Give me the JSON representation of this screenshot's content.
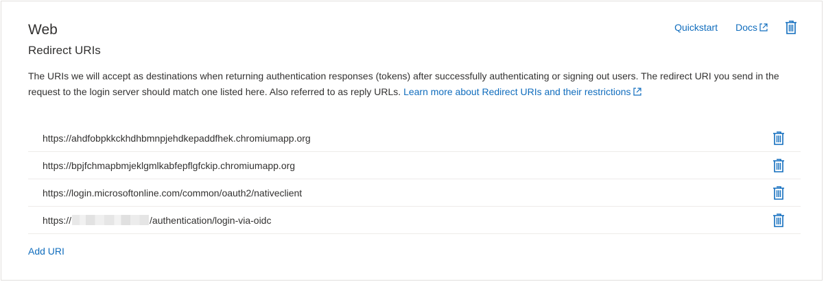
{
  "section": {
    "title": "Web",
    "subtitle": "Redirect URIs",
    "quickstart_label": "Quickstart",
    "docs_label": "Docs",
    "description_text": "The URIs we will accept as destinations when returning authentication responses (tokens) after successfully authenticating or signing out users. The redirect URI you send in the request to the login server should match one listed here. Also referred to as reply URLs. ",
    "learn_more_label": "Learn more about Redirect URIs and their restrictions",
    "add_uri_label": "Add URI"
  },
  "redirect_uris": [
    {
      "prefix": "https://ahdfobpkkckhdhbmnpjehdkepaddfhek.chromiumapp.org",
      "suffix": ""
    },
    {
      "prefix": "https://bpjfchmapbmjeklgmlkabfepflgfckip.chromiumapp.org",
      "suffix": ""
    },
    {
      "prefix": "https://login.microsoftonline.com/common/oauth2/nativeclient",
      "suffix": ""
    },
    {
      "prefix": "https://",
      "suffix": "/authentication/login-via-oidc",
      "redacted": true
    }
  ],
  "icons": {
    "delete": "trash-icon",
    "external": "external-link-icon"
  },
  "colors": {
    "accent": "#0f6cbd",
    "text": "#323130",
    "border": "#e1dfdd",
    "divider": "#edebe9"
  }
}
